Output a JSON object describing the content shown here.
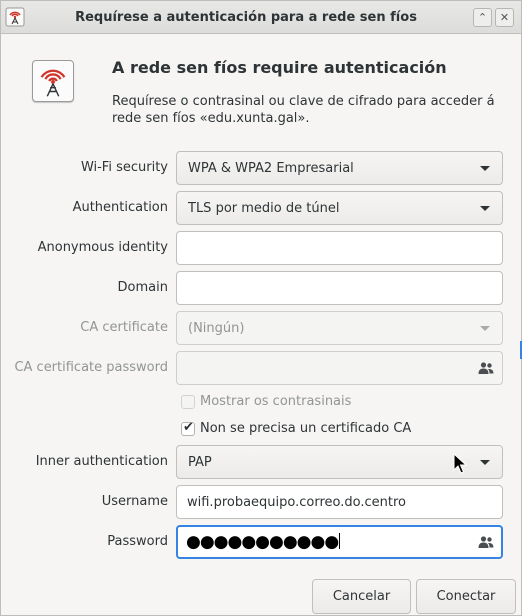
{
  "window": {
    "title": "Requírese a autenticación para a rede sen fíos",
    "icon": "wifi-tower-icon"
  },
  "titlebar_buttons": {
    "up": "⌃",
    "close": "✕"
  },
  "header": {
    "heading": "A rede sen fíos require autenticación",
    "description": "Requírese o contrasinal ou clave de cifrado para acceder á rede sen fíos «edu.xunta.gal»."
  },
  "form": {
    "wifi_security": {
      "label": "Wi-Fi security",
      "value": "WPA & WPA2 Empresarial"
    },
    "authentication": {
      "label": "Authentication",
      "value": "TLS por medio de túnel"
    },
    "anonymous_identity": {
      "label": "Anonymous identity",
      "value": ""
    },
    "domain": {
      "label": "Domain",
      "value": ""
    },
    "ca_certificate": {
      "label": "CA certificate",
      "value": "(Ningún)"
    },
    "ca_certificate_password": {
      "label": "CA certificate password",
      "value": ""
    },
    "show_passwords": {
      "label": "Mostrar os contrasinais",
      "checked": false
    },
    "no_ca_required": {
      "label": "Non se precisa un certificado CA",
      "checked": true
    },
    "inner_authentication": {
      "label": "Inner authentication",
      "value": "PAP"
    },
    "username": {
      "label": "Username",
      "value": "wifi.probaequipo.correo.do.centro"
    },
    "password": {
      "label": "Password",
      "masked": "●●●●●●●●●●●"
    }
  },
  "buttons": {
    "cancel": "Cancelar",
    "connect": "Conectar"
  },
  "colors": {
    "accent": "#3584e4",
    "signal_red": "#d0352b"
  }
}
